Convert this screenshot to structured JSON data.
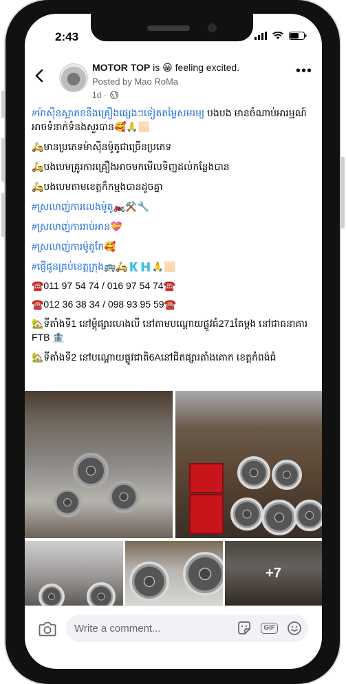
{
  "status": {
    "time": "2:43"
  },
  "post": {
    "page_name": "MOTOR TOP",
    "action": " is 😀 feeling excited.",
    "posted_by": "Posted by Mao RoMa",
    "age": "1d ·"
  },
  "text": {
    "line1_hash": "#ម៉ាសុីនស្អាតខនឹងគ្រឿងផ្សេងៗទៀតតម្លៃសមរម្យ",
    "line1_rest": " បងបង មានចំណាប់អារម្មណ៍ អាចទំនាក់ទំនងសួរបាន🥰🙏🏻",
    "line2": "🛵មានប្រភេទម៉ាសុីនម៉ូតូជាច្រើនប្រភេទ",
    "line3": "🛵បងបេមគ្រូរការគ្រឿងអាចមកមើលទិញដល់កន្លែងបាន",
    "line4": "🛵បងបេមតាមខេត្តក៏កម្មងបានដូចគ្នា",
    "line5": "#ស្រលាញ់ការលេងម៉ូតូ🏍️⚒️🔧",
    "line6": "#ស្រលាញ់ការរាប់អាន💝",
    "line7": "#ស្រលាញ់ការម៉ូតូកែ🥰",
    "line8": "#ផ្ញើជូនគ្រប់ខេត្តក្រុង🚌🛵🇰🇭🙏🏻",
    "phone1": "☎️011 97 54 74 / 016 97 54 74☎️",
    "phone2": "☎️012 36 38 34 / 098 93 95 59☎️",
    "addr1": "🏡ទីតាំងទី1 នៅម្តុំផ្សារហេងលី នៅតាមបណ្តោយផ្លូវធំ271តែម្តង នៅជាធនាគារ FTB 🏦",
    "addr2": "🏡ទីតាំងទី2 នៅបណ្តោយផ្លូវជាតិ6Aនៅជិតផ្សារតាំងគោក ខេត្តកំពង់ធំ"
  },
  "photos": {
    "more_count": "+7"
  },
  "comment": {
    "placeholder": "Write a comment..."
  },
  "colors": {
    "hashtag": "#216fdb",
    "muted": "#65676b"
  }
}
